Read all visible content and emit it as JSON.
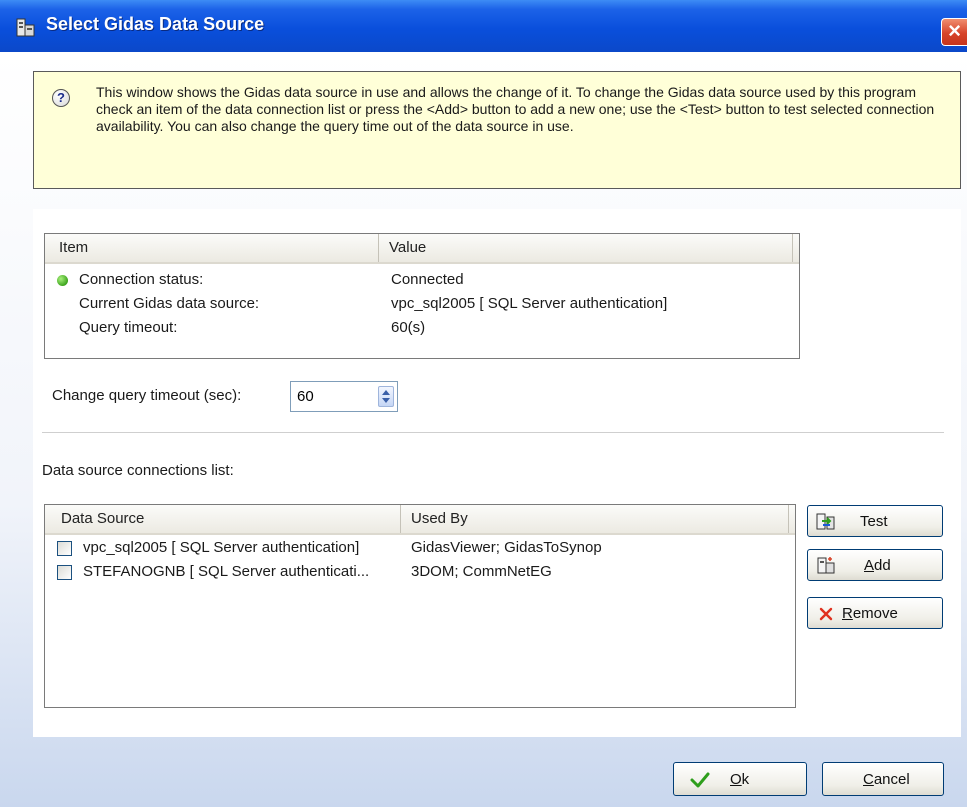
{
  "window": {
    "title": "Select Gidas Data Source",
    "close_glyph": "×"
  },
  "info": {
    "icon_glyph": "?",
    "text": "This window shows the Gidas data source in use and allows the change of it. To change the Gidas data source used by this program check an item of the data connection list or press the <Add> button to add a new one; use the <Test> button to test selected connection availability. You can also change the query time out of the data source in use."
  },
  "status_list": {
    "columns": [
      "Item",
      "Value"
    ],
    "rows": [
      {
        "item": "Connection status:",
        "value": "Connected"
      },
      {
        "item": "Current Gidas data source:",
        "value": "vpc_sql2005 [ SQL Server authentication]"
      },
      {
        "item": "Query timeout:",
        "value": "60(s)"
      }
    ],
    "status_color": "#3ea51e"
  },
  "timeout": {
    "label": "Change query timeout (sec):",
    "value": "60"
  },
  "connections": {
    "label": "Data source connections list:",
    "columns": [
      "Data Source",
      "Used By"
    ],
    "rows": [
      {
        "source": "vpc_sql2005 [ SQL Server authentication]",
        "used_by": "GidasViewer; GidasToSynop",
        "checked": false
      },
      {
        "source": "STEFANOGNB [ SQL Server authenticati...",
        "used_by": "3DOM; CommNetEG",
        "checked": false
      }
    ]
  },
  "buttons": {
    "test": "Test",
    "add_prefix": "",
    "add_underlined": "A",
    "add_rest": "dd",
    "remove_underlined": "R",
    "remove_rest": "emove",
    "ok_underlined": "O",
    "ok_rest": "k",
    "cancel_underlined": "C",
    "cancel_rest": "ancel"
  },
  "colors": {
    "titlebar": "#0a4fdc",
    "info_background": "#ffffd8",
    "button_border": "#003c74",
    "remove_icon": "#e0301e",
    "ok_icon": "#2e9e1c"
  },
  "icons": {
    "title": "data-source-window-icon",
    "help": "help-question-icon",
    "status": "green-status-dot-icon",
    "test": "test-connection-icon",
    "add": "add-connection-icon",
    "remove": "remove-x-icon",
    "ok": "checkmark-icon"
  }
}
